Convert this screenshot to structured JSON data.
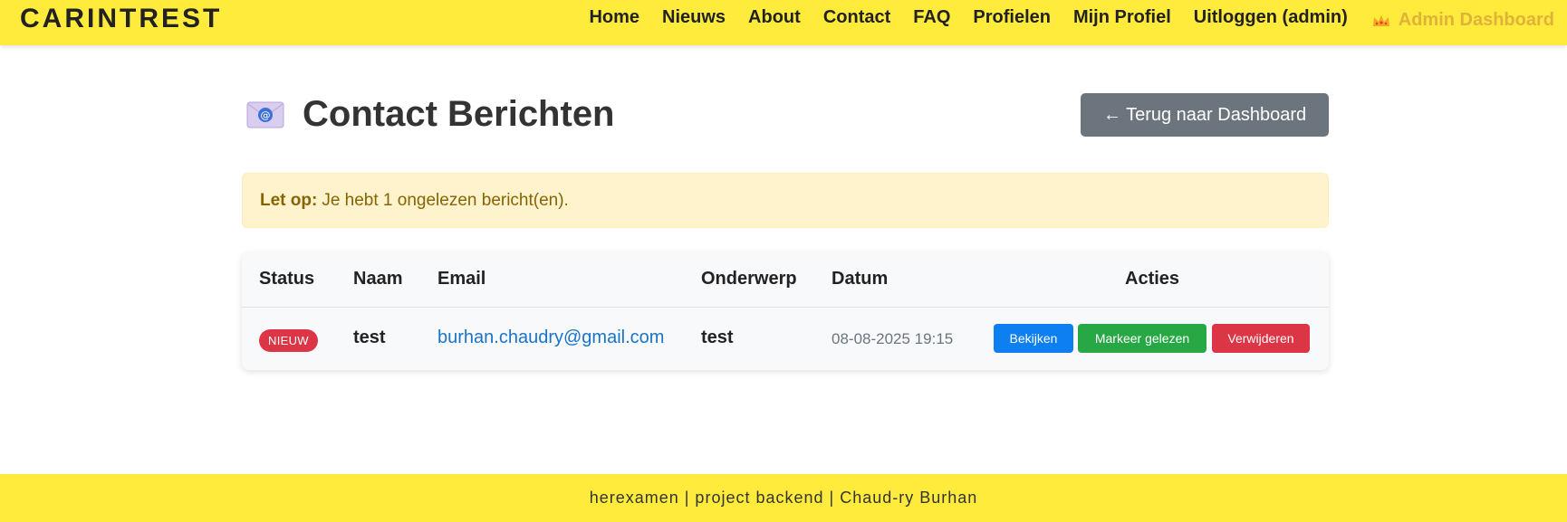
{
  "nav": {
    "brand": "CARINTREST",
    "links": [
      "Home",
      "Nieuws",
      "About",
      "Contact",
      "FAQ",
      "Profielen",
      "Mijn Profiel",
      "Uitloggen (admin)"
    ],
    "admin_link": "Admin Dashboard",
    "admin_icon": "crown-icon"
  },
  "page": {
    "title": "Contact Berichten",
    "title_icon": "mail-at-icon",
    "back_button": "← Terug naar Dashboard"
  },
  "alert": {
    "strong": "Let op:",
    "text": "Je hebt 1 ongelezen bericht(en)."
  },
  "table": {
    "headers": {
      "status": "Status",
      "naam": "Naam",
      "email": "Email",
      "onderwerp": "Onderwerp",
      "datum": "Datum",
      "acties": "Acties"
    },
    "rows": [
      {
        "status": "NIEUW",
        "naam": "test",
        "email": "burhan.chaudry@gmail.com",
        "onderwerp": "test",
        "datum": "08-08-2025 19:15",
        "actions": {
          "view": "Bekijken",
          "mark_read": "Markeer gelezen",
          "delete": "Verwijderen"
        }
      }
    ]
  },
  "footer": {
    "text": "herexamen | project backend | Chaud-ry Burhan"
  },
  "colors": {
    "navbar": "#ffeb3b",
    "admin_link": "#e1b23a",
    "secondary_button": "#6c757d",
    "alert_bg": "#fff3cd",
    "alert_text": "#856404",
    "badge": "#dc3545",
    "view_button": "#0d7ff0",
    "mark_read_button": "#28a745",
    "delete_button": "#dc3545",
    "link": "#1a73c9"
  }
}
